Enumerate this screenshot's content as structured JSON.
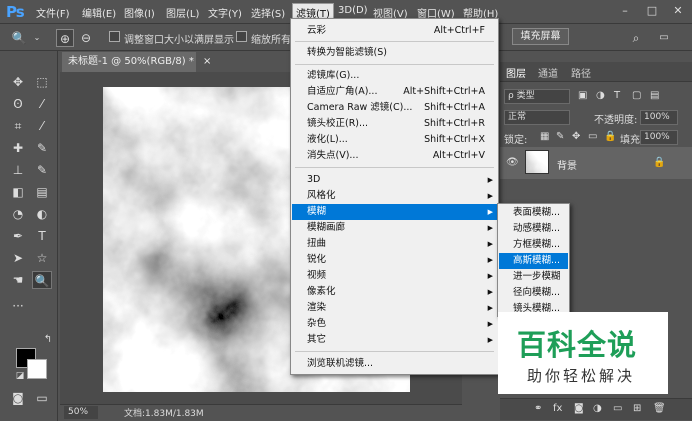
{
  "app": {
    "logo": "Ps"
  },
  "menubar": {
    "items": [
      "文件(F)",
      "编辑(E)",
      "图像(I)",
      "图层(L)",
      "文字(Y)",
      "选择(S)",
      "滤镜(T)",
      "3D(D)",
      "视图(V)",
      "窗口(W)",
      "帮助(H)"
    ],
    "window_buttons": [
      "–",
      "□",
      "✕"
    ]
  },
  "options_bar": {
    "tool_icon": "zoom-tool-icon",
    "checkbox1_label": "调整窗口大小以满屏显示",
    "checkbox2_label": "缩放所有窗",
    "fill_screen_button": "填充屏幕"
  },
  "document": {
    "tab_title": "未标题-1 @ 50%(RGB/8) *",
    "tab_close": "×",
    "zoom": "50%",
    "size": "文档:1.83M/1.83M"
  },
  "filter_menu": {
    "items": [
      {
        "label": "云彩",
        "shortcut": "Alt+Ctrl+F"
      },
      {
        "label": "转换为智能滤镜(S)",
        "shortcut": ""
      },
      {
        "label": "滤镜库(G)...",
        "shortcut": ""
      },
      {
        "label": "自适应广角(A)...",
        "shortcut": "Alt+Shift+Ctrl+A"
      },
      {
        "label": "Camera Raw 滤镜(C)...",
        "shortcut": "Shift+Ctrl+A"
      },
      {
        "label": "镜头校正(R)...",
        "shortcut": "Shift+Ctrl+R"
      },
      {
        "label": "液化(L)...",
        "shortcut": "Shift+Ctrl+X"
      },
      {
        "label": "消失点(V)...",
        "shortcut": "Alt+Ctrl+V"
      },
      {
        "label": "3D",
        "shortcut": "▶"
      },
      {
        "label": "风格化",
        "shortcut": "▶"
      },
      {
        "label": "模糊",
        "shortcut": "▶"
      },
      {
        "label": "模糊画廊",
        "shortcut": "▶"
      },
      {
        "label": "扭曲",
        "shortcut": "▶"
      },
      {
        "label": "锐化",
        "shortcut": "▶"
      },
      {
        "label": "视频",
        "shortcut": "▶"
      },
      {
        "label": "像素化",
        "shortcut": "▶"
      },
      {
        "label": "渲染",
        "shortcut": "▶"
      },
      {
        "label": "杂色",
        "shortcut": "▶"
      },
      {
        "label": "其它",
        "shortcut": "▶"
      },
      {
        "label": "浏览联机滤镜...",
        "shortcut": ""
      }
    ]
  },
  "blur_submenu": {
    "items": [
      "表面模糊...",
      "动感模糊...",
      "方框模糊...",
      "高斯模糊...",
      "进一步模糊",
      "径向模糊...",
      "镜头模糊..."
    ],
    "highlighted": "高斯模糊..."
  },
  "layers_panel": {
    "tabs": [
      "图层",
      "通道",
      "路径"
    ],
    "kind_filter": "ρ 类型",
    "blend_mode": "正常",
    "opacity_label": "不透明度:",
    "opacity_value": "100%",
    "lock_label": "锁定:",
    "fill_label": "填充:",
    "fill_value": "100%",
    "layer_name": "背景"
  },
  "watermark": {
    "main": "百科全说",
    "sub": "助你轻松解决"
  },
  "colors": {
    "highlight": "#0078d7",
    "watermark_green": "#1e9e58",
    "panel_bg": "#535353"
  }
}
